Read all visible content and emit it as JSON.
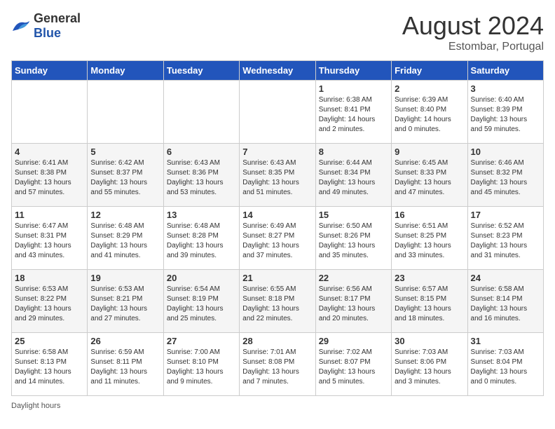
{
  "header": {
    "logo_general": "General",
    "logo_blue": "Blue",
    "month_year": "August 2024",
    "location": "Estombar, Portugal"
  },
  "days_of_week": [
    "Sunday",
    "Monday",
    "Tuesday",
    "Wednesday",
    "Thursday",
    "Friday",
    "Saturday"
  ],
  "weeks": [
    [
      {
        "day": "",
        "info": ""
      },
      {
        "day": "",
        "info": ""
      },
      {
        "day": "",
        "info": ""
      },
      {
        "day": "",
        "info": ""
      },
      {
        "day": "1",
        "info": "Sunrise: 6:38 AM\nSunset: 8:41 PM\nDaylight: 14 hours\nand 2 minutes."
      },
      {
        "day": "2",
        "info": "Sunrise: 6:39 AM\nSunset: 8:40 PM\nDaylight: 14 hours\nand 0 minutes."
      },
      {
        "day": "3",
        "info": "Sunrise: 6:40 AM\nSunset: 8:39 PM\nDaylight: 13 hours\nand 59 minutes."
      }
    ],
    [
      {
        "day": "4",
        "info": "Sunrise: 6:41 AM\nSunset: 8:38 PM\nDaylight: 13 hours\nand 57 minutes."
      },
      {
        "day": "5",
        "info": "Sunrise: 6:42 AM\nSunset: 8:37 PM\nDaylight: 13 hours\nand 55 minutes."
      },
      {
        "day": "6",
        "info": "Sunrise: 6:43 AM\nSunset: 8:36 PM\nDaylight: 13 hours\nand 53 minutes."
      },
      {
        "day": "7",
        "info": "Sunrise: 6:43 AM\nSunset: 8:35 PM\nDaylight: 13 hours\nand 51 minutes."
      },
      {
        "day": "8",
        "info": "Sunrise: 6:44 AM\nSunset: 8:34 PM\nDaylight: 13 hours\nand 49 minutes."
      },
      {
        "day": "9",
        "info": "Sunrise: 6:45 AM\nSunset: 8:33 PM\nDaylight: 13 hours\nand 47 minutes."
      },
      {
        "day": "10",
        "info": "Sunrise: 6:46 AM\nSunset: 8:32 PM\nDaylight: 13 hours\nand 45 minutes."
      }
    ],
    [
      {
        "day": "11",
        "info": "Sunrise: 6:47 AM\nSunset: 8:31 PM\nDaylight: 13 hours\nand 43 minutes."
      },
      {
        "day": "12",
        "info": "Sunrise: 6:48 AM\nSunset: 8:29 PM\nDaylight: 13 hours\nand 41 minutes."
      },
      {
        "day": "13",
        "info": "Sunrise: 6:48 AM\nSunset: 8:28 PM\nDaylight: 13 hours\nand 39 minutes."
      },
      {
        "day": "14",
        "info": "Sunrise: 6:49 AM\nSunset: 8:27 PM\nDaylight: 13 hours\nand 37 minutes."
      },
      {
        "day": "15",
        "info": "Sunrise: 6:50 AM\nSunset: 8:26 PM\nDaylight: 13 hours\nand 35 minutes."
      },
      {
        "day": "16",
        "info": "Sunrise: 6:51 AM\nSunset: 8:25 PM\nDaylight: 13 hours\nand 33 minutes."
      },
      {
        "day": "17",
        "info": "Sunrise: 6:52 AM\nSunset: 8:23 PM\nDaylight: 13 hours\nand 31 minutes."
      }
    ],
    [
      {
        "day": "18",
        "info": "Sunrise: 6:53 AM\nSunset: 8:22 PM\nDaylight: 13 hours\nand 29 minutes."
      },
      {
        "day": "19",
        "info": "Sunrise: 6:53 AM\nSunset: 8:21 PM\nDaylight: 13 hours\nand 27 minutes."
      },
      {
        "day": "20",
        "info": "Sunrise: 6:54 AM\nSunset: 8:19 PM\nDaylight: 13 hours\nand 25 minutes."
      },
      {
        "day": "21",
        "info": "Sunrise: 6:55 AM\nSunset: 8:18 PM\nDaylight: 13 hours\nand 22 minutes."
      },
      {
        "day": "22",
        "info": "Sunrise: 6:56 AM\nSunset: 8:17 PM\nDaylight: 13 hours\nand 20 minutes."
      },
      {
        "day": "23",
        "info": "Sunrise: 6:57 AM\nSunset: 8:15 PM\nDaylight: 13 hours\nand 18 minutes."
      },
      {
        "day": "24",
        "info": "Sunrise: 6:58 AM\nSunset: 8:14 PM\nDaylight: 13 hours\nand 16 minutes."
      }
    ],
    [
      {
        "day": "25",
        "info": "Sunrise: 6:58 AM\nSunset: 8:13 PM\nDaylight: 13 hours\nand 14 minutes."
      },
      {
        "day": "26",
        "info": "Sunrise: 6:59 AM\nSunset: 8:11 PM\nDaylight: 13 hours\nand 11 minutes."
      },
      {
        "day": "27",
        "info": "Sunrise: 7:00 AM\nSunset: 8:10 PM\nDaylight: 13 hours\nand 9 minutes."
      },
      {
        "day": "28",
        "info": "Sunrise: 7:01 AM\nSunset: 8:08 PM\nDaylight: 13 hours\nand 7 minutes."
      },
      {
        "day": "29",
        "info": "Sunrise: 7:02 AM\nSunset: 8:07 PM\nDaylight: 13 hours\nand 5 minutes."
      },
      {
        "day": "30",
        "info": "Sunrise: 7:03 AM\nSunset: 8:06 PM\nDaylight: 13 hours\nand 3 minutes."
      },
      {
        "day": "31",
        "info": "Sunrise: 7:03 AM\nSunset: 8:04 PM\nDaylight: 13 hours\nand 0 minutes."
      }
    ]
  ],
  "footer": {
    "daylight_hours_label": "Daylight hours"
  }
}
